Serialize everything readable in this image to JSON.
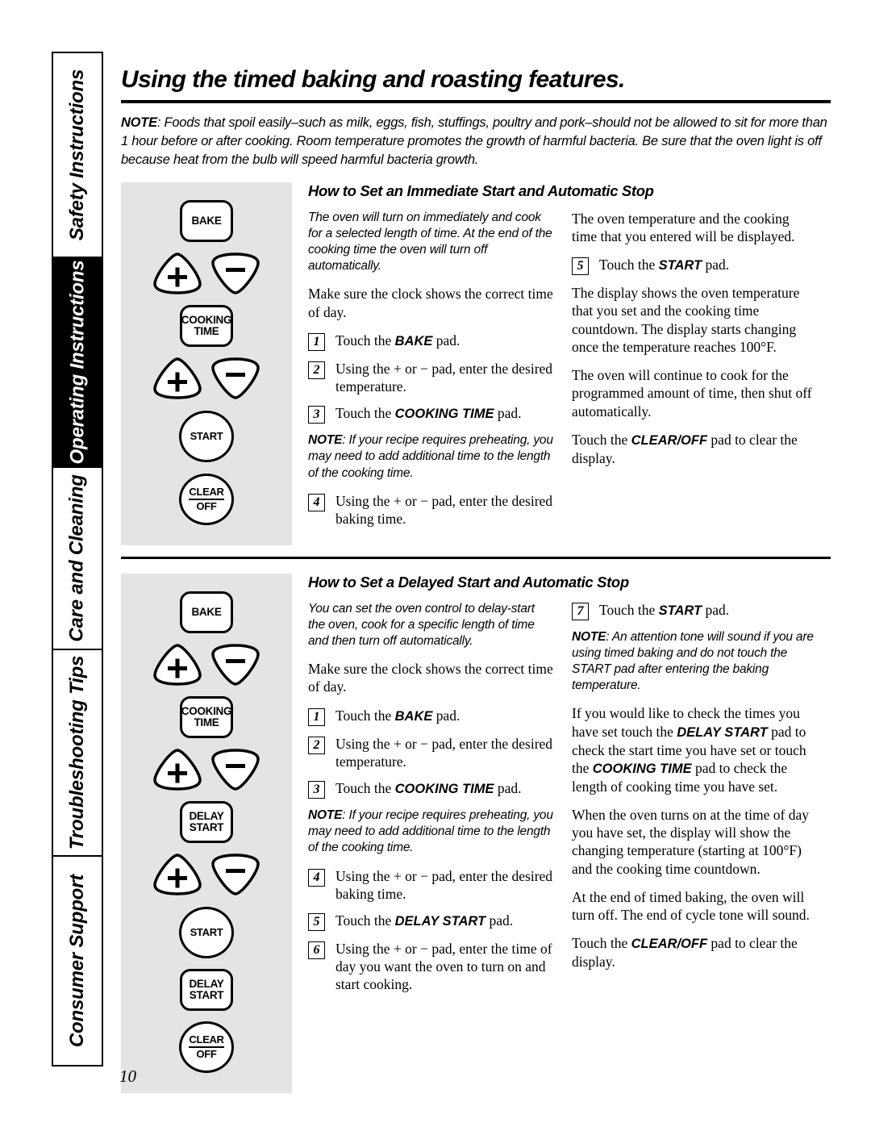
{
  "sidebar": {
    "tabs": [
      {
        "label": "Safety Instructions",
        "active": false
      },
      {
        "label": "Operating Instructions",
        "active": true
      },
      {
        "label": "Care and Cleaning",
        "active": false
      },
      {
        "label": "Troubleshooting Tips",
        "active": false
      },
      {
        "label": "Consumer Support",
        "active": false
      }
    ]
  },
  "page": {
    "title": "Using the timed baking and roasting features.",
    "number": "10",
    "intro_note_label": "NOTE",
    "intro_note": ": Foods that spoil easily–such as milk, eggs, fish, stuffings, poultry and pork–should not be allowed to sit for more than 1 hour before or after cooking. Room temperature promotes the growth of harmful bacteria. Be sure that the oven light is off because heat from the bulb will speed harmful bacteria growth."
  },
  "pads": {
    "bake": "BAKE",
    "cooking_time_l1": "COOKING",
    "cooking_time_l2": "TIME",
    "delay_start_l1": "DELAY",
    "delay_start_l2": "START",
    "start": "START",
    "clear": "CLEAR",
    "off": "OFF",
    "plus": "+",
    "minus": "−"
  },
  "section1": {
    "heading": "How to Set an Immediate Start and Automatic Stop",
    "panel_pads": [
      "BAKE",
      "plus-minus",
      "COOKING TIME",
      "plus-minus",
      "START",
      "CLEAR/OFF"
    ],
    "left": {
      "intro": "The oven will turn on immediately and cook for a selected length of time. At the end of the cooking time the oven will turn off automatically.",
      "clock": "Make sure the clock shows the correct time of day.",
      "steps": [
        {
          "num": "1",
          "pre": "Touch the ",
          "strong": "BAKE",
          "post": " pad."
        },
        {
          "num": "2",
          "pre": "Using the + or − pad, enter the desired temperature.",
          "strong": "",
          "post": ""
        },
        {
          "num": "3",
          "pre": "Touch the ",
          "strong": "COOKING TIME",
          "post": " pad."
        }
      ],
      "note_label": "NOTE",
      "note": ": If your recipe requires preheating, you may need to add additional time to the length of the cooking time.",
      "step4": {
        "num": "4",
        "text": "Using the + or − pad, enter the desired baking time."
      }
    },
    "right": {
      "p1": "The oven temperature and the cooking time that you entered will be displayed.",
      "step5": {
        "num": "5",
        "pre": "Touch the ",
        "strong": "START",
        "post": " pad."
      },
      "p2": "The display shows the oven temperature that you set and the cooking time countdown. The display starts changing once the temperature reaches 100°F.",
      "p3": "The oven will continue to cook for the programmed amount of time, then shut off automatically.",
      "p4_pre": "Touch the ",
      "p4_strong": "CLEAR/OFF",
      "p4_post": " pad to clear the display."
    }
  },
  "section2": {
    "heading": "How to Set a Delayed Start and Automatic Stop",
    "panel_pads": [
      "BAKE",
      "plus-minus",
      "COOKING TIME",
      "plus-minus",
      "DELAY START",
      "plus-minus",
      "START",
      "DELAY START",
      "CLEAR/OFF"
    ],
    "left": {
      "intro": "You can set the oven control to delay-start the oven, cook for a specific length of time and then turn off automatically.",
      "clock": "Make sure the clock shows the correct time of day.",
      "steps": [
        {
          "num": "1",
          "pre": "Touch the ",
          "strong": "BAKE",
          "post": " pad."
        },
        {
          "num": "2",
          "pre": "Using the + or − pad, enter the desired temperature.",
          "strong": "",
          "post": ""
        },
        {
          "num": "3",
          "pre": "Touch the ",
          "strong": "COOKING TIME",
          "post": " pad."
        }
      ],
      "note_label": "NOTE",
      "note": ": If your recipe requires preheating, you may need to add additional time to the length of the cooking time.",
      "step4": {
        "num": "4",
        "text": "Using the + or − pad, enter the desired baking time."
      },
      "step5": {
        "num": "5",
        "pre": "Touch the ",
        "strong": "DELAY START",
        "post": " pad."
      },
      "step6": {
        "num": "6",
        "text": "Using the + or − pad, enter the time of day you want the oven to turn on and start cooking."
      }
    },
    "right": {
      "step7": {
        "num": "7",
        "pre": "Touch the ",
        "strong": "START",
        "post": " pad."
      },
      "note_label": "NOTE",
      "note": ": An attention tone will sound if you are using timed baking and do not touch the START pad after entering the baking temperature.",
      "p1_a": "If you would like to check the times you have set touch the ",
      "p1_b": "DELAY START",
      "p1_c": " pad to check the start time you have set or touch the ",
      "p1_d": "COOKING TIME",
      "p1_e": " pad to check the length of cooking time you have set.",
      "p2": "When the oven turns on at the time of day you have set, the display will show the changing temperature (starting at 100°F) and the cooking time countdown.",
      "p3": "At the end of timed baking, the oven will turn off. The end of cycle tone will sound.",
      "p4_pre": "Touch the ",
      "p4_strong": "CLEAR/OFF",
      "p4_post": " pad to clear the display."
    }
  }
}
